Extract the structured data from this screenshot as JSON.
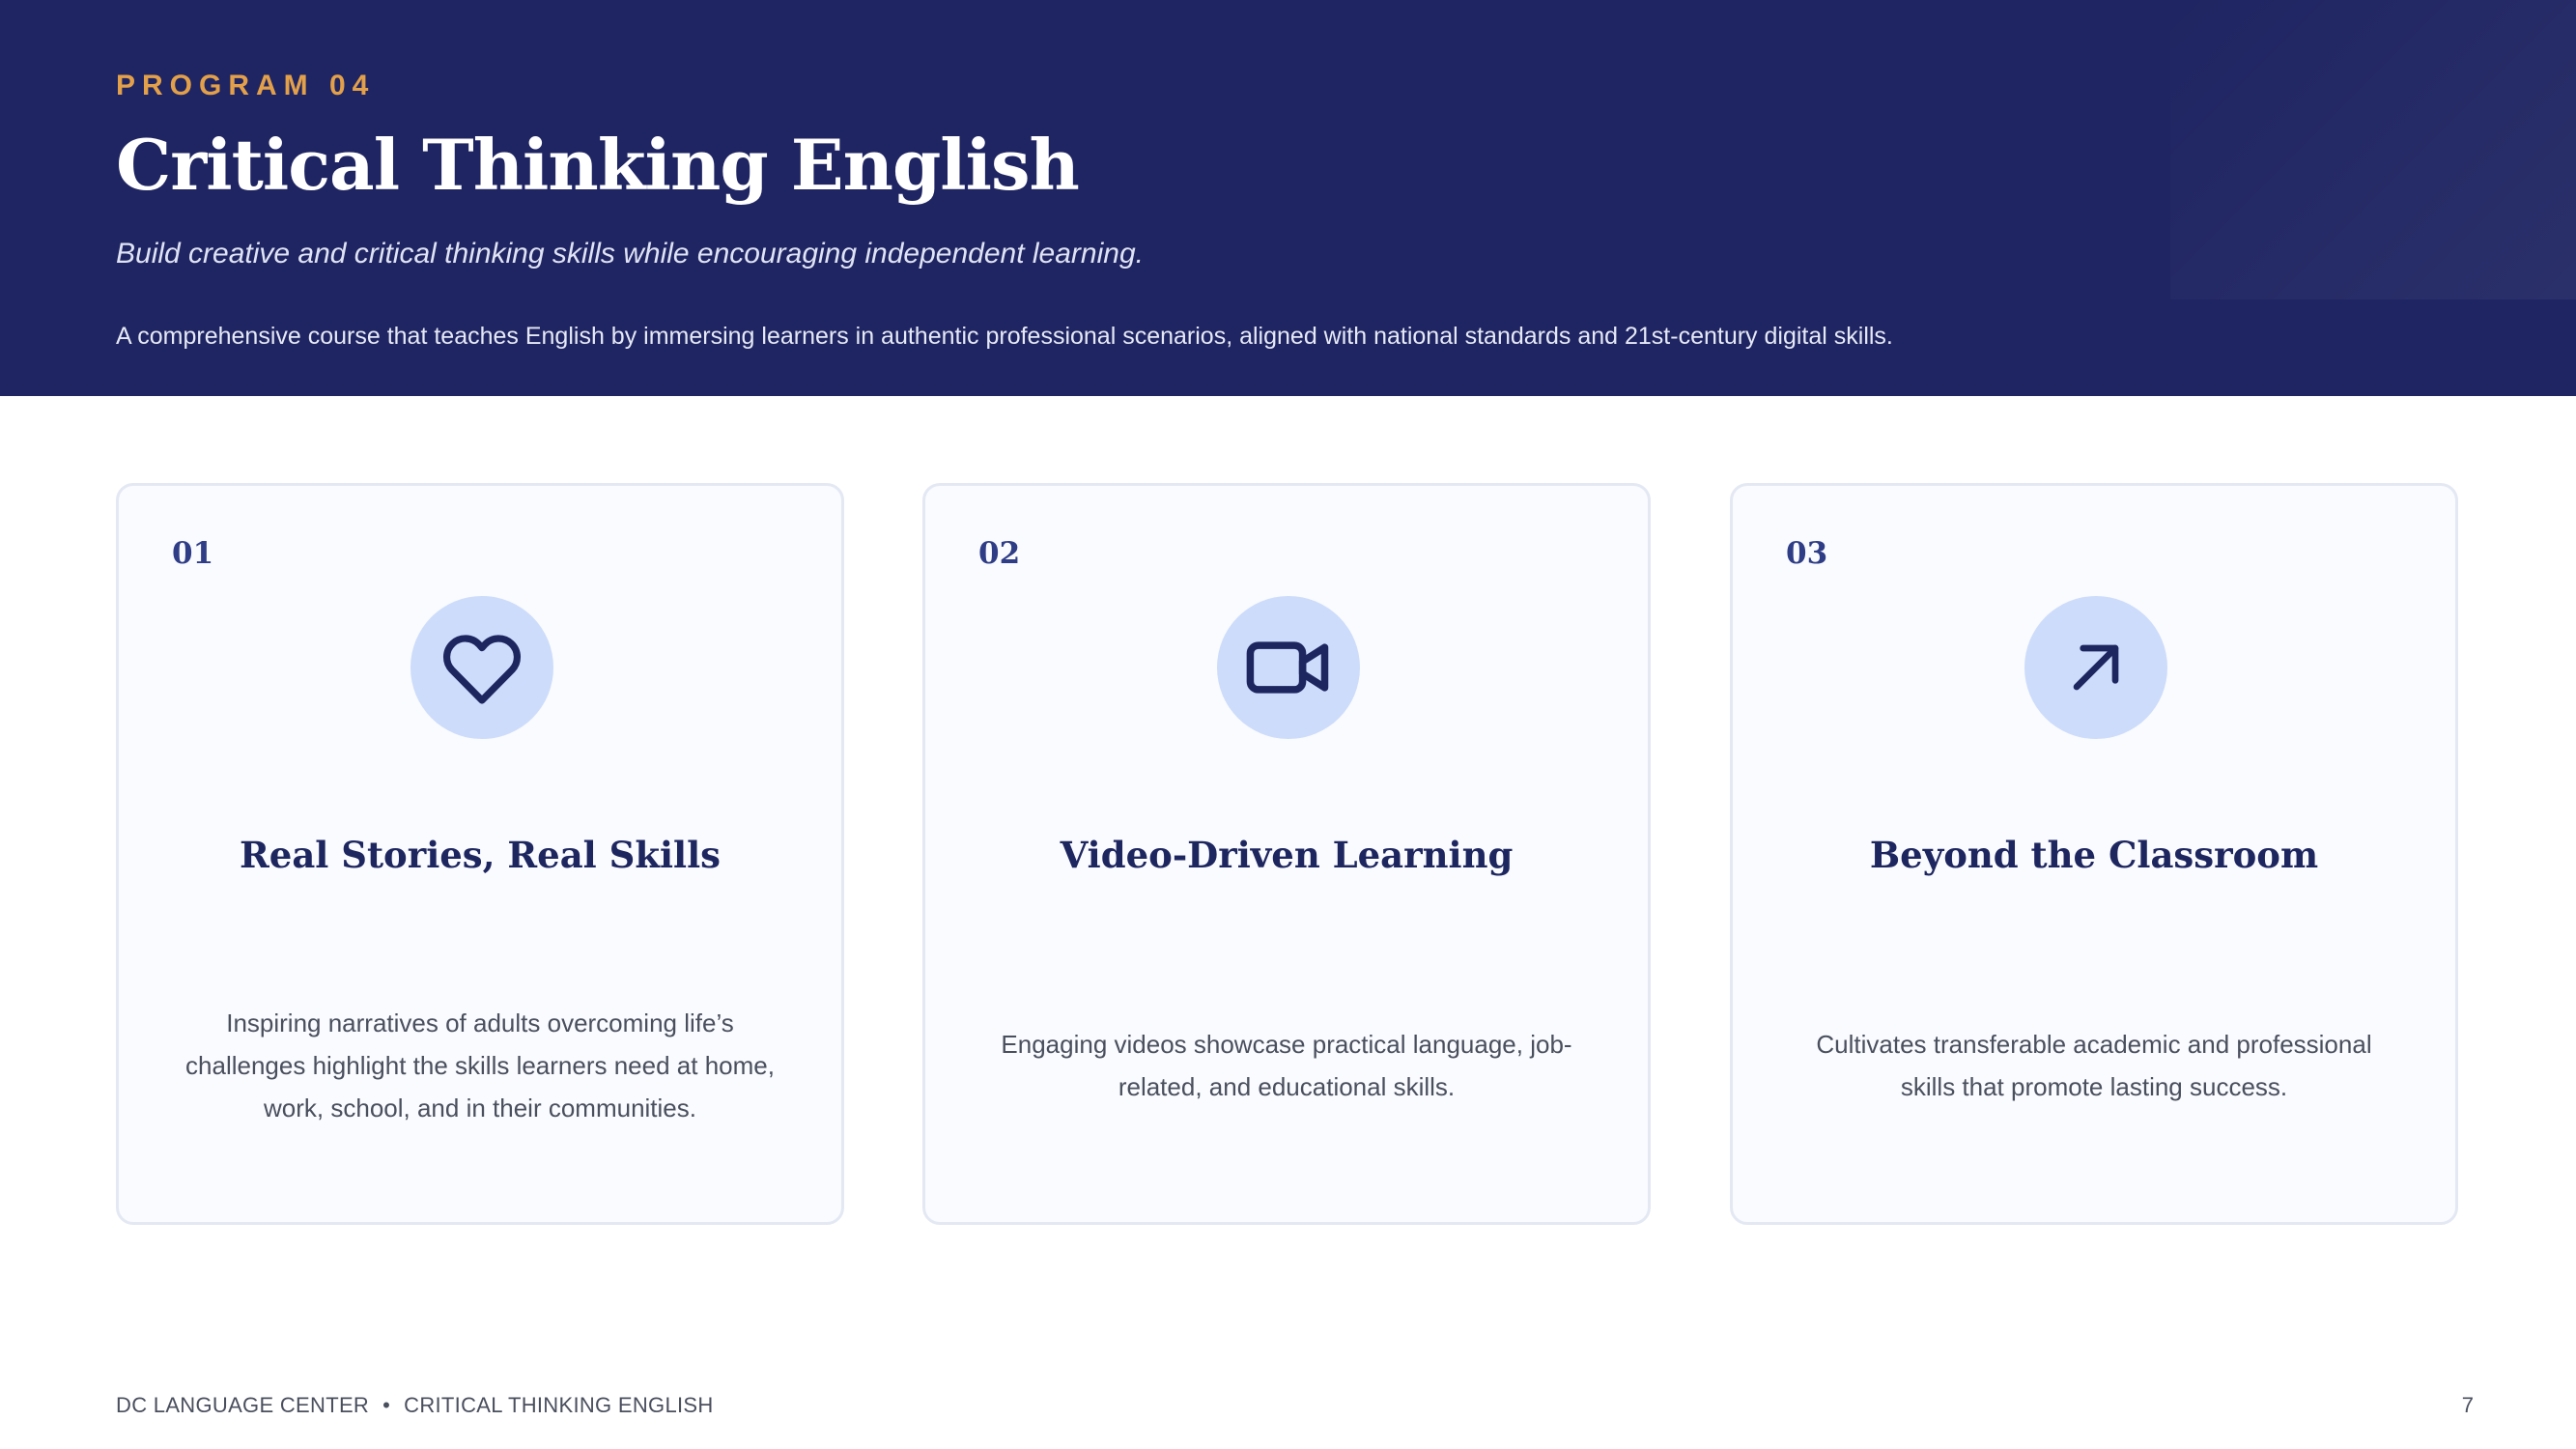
{
  "header": {
    "eyebrow": "PROGRAM 04",
    "title": "Critical Thinking English",
    "subtitle": "Build creative and critical thinking skills while encouraging independent learning.",
    "description": "A comprehensive course that teaches English by immersing learners in authentic professional scenarios, aligned with national standards and 21st-century digital skills."
  },
  "cards": [
    {
      "number": "01",
      "icon": "heart-icon",
      "title": "Real Stories, Real Skills",
      "text": "Inspiring narratives of adults overcoming life’s challenges highlight the skills learners need at home, work, school, and in their communities."
    },
    {
      "number": "02",
      "icon": "video-camera-icon",
      "title": "Video-Driven Learning",
      "text": "Engaging videos showcase practical language, job-related, and educational skills."
    },
    {
      "number": "03",
      "icon": "arrow-up-right-icon",
      "title": "Beyond the Classroom",
      "text": "Cultivates transferable academic and professional skills that promote lasting success."
    }
  ],
  "footer": {
    "org": "DC LANGUAGE CENTER",
    "separator": "•",
    "course": "CRITICAL THINKING ENGLISH",
    "page_number": "7"
  },
  "colors": {
    "header_bg": "#1f2562",
    "accent": "#e3a04b",
    "card_bg": "#f9fbfe",
    "icon_circle": "#cddcfb",
    "heading": "#1e2660"
  }
}
